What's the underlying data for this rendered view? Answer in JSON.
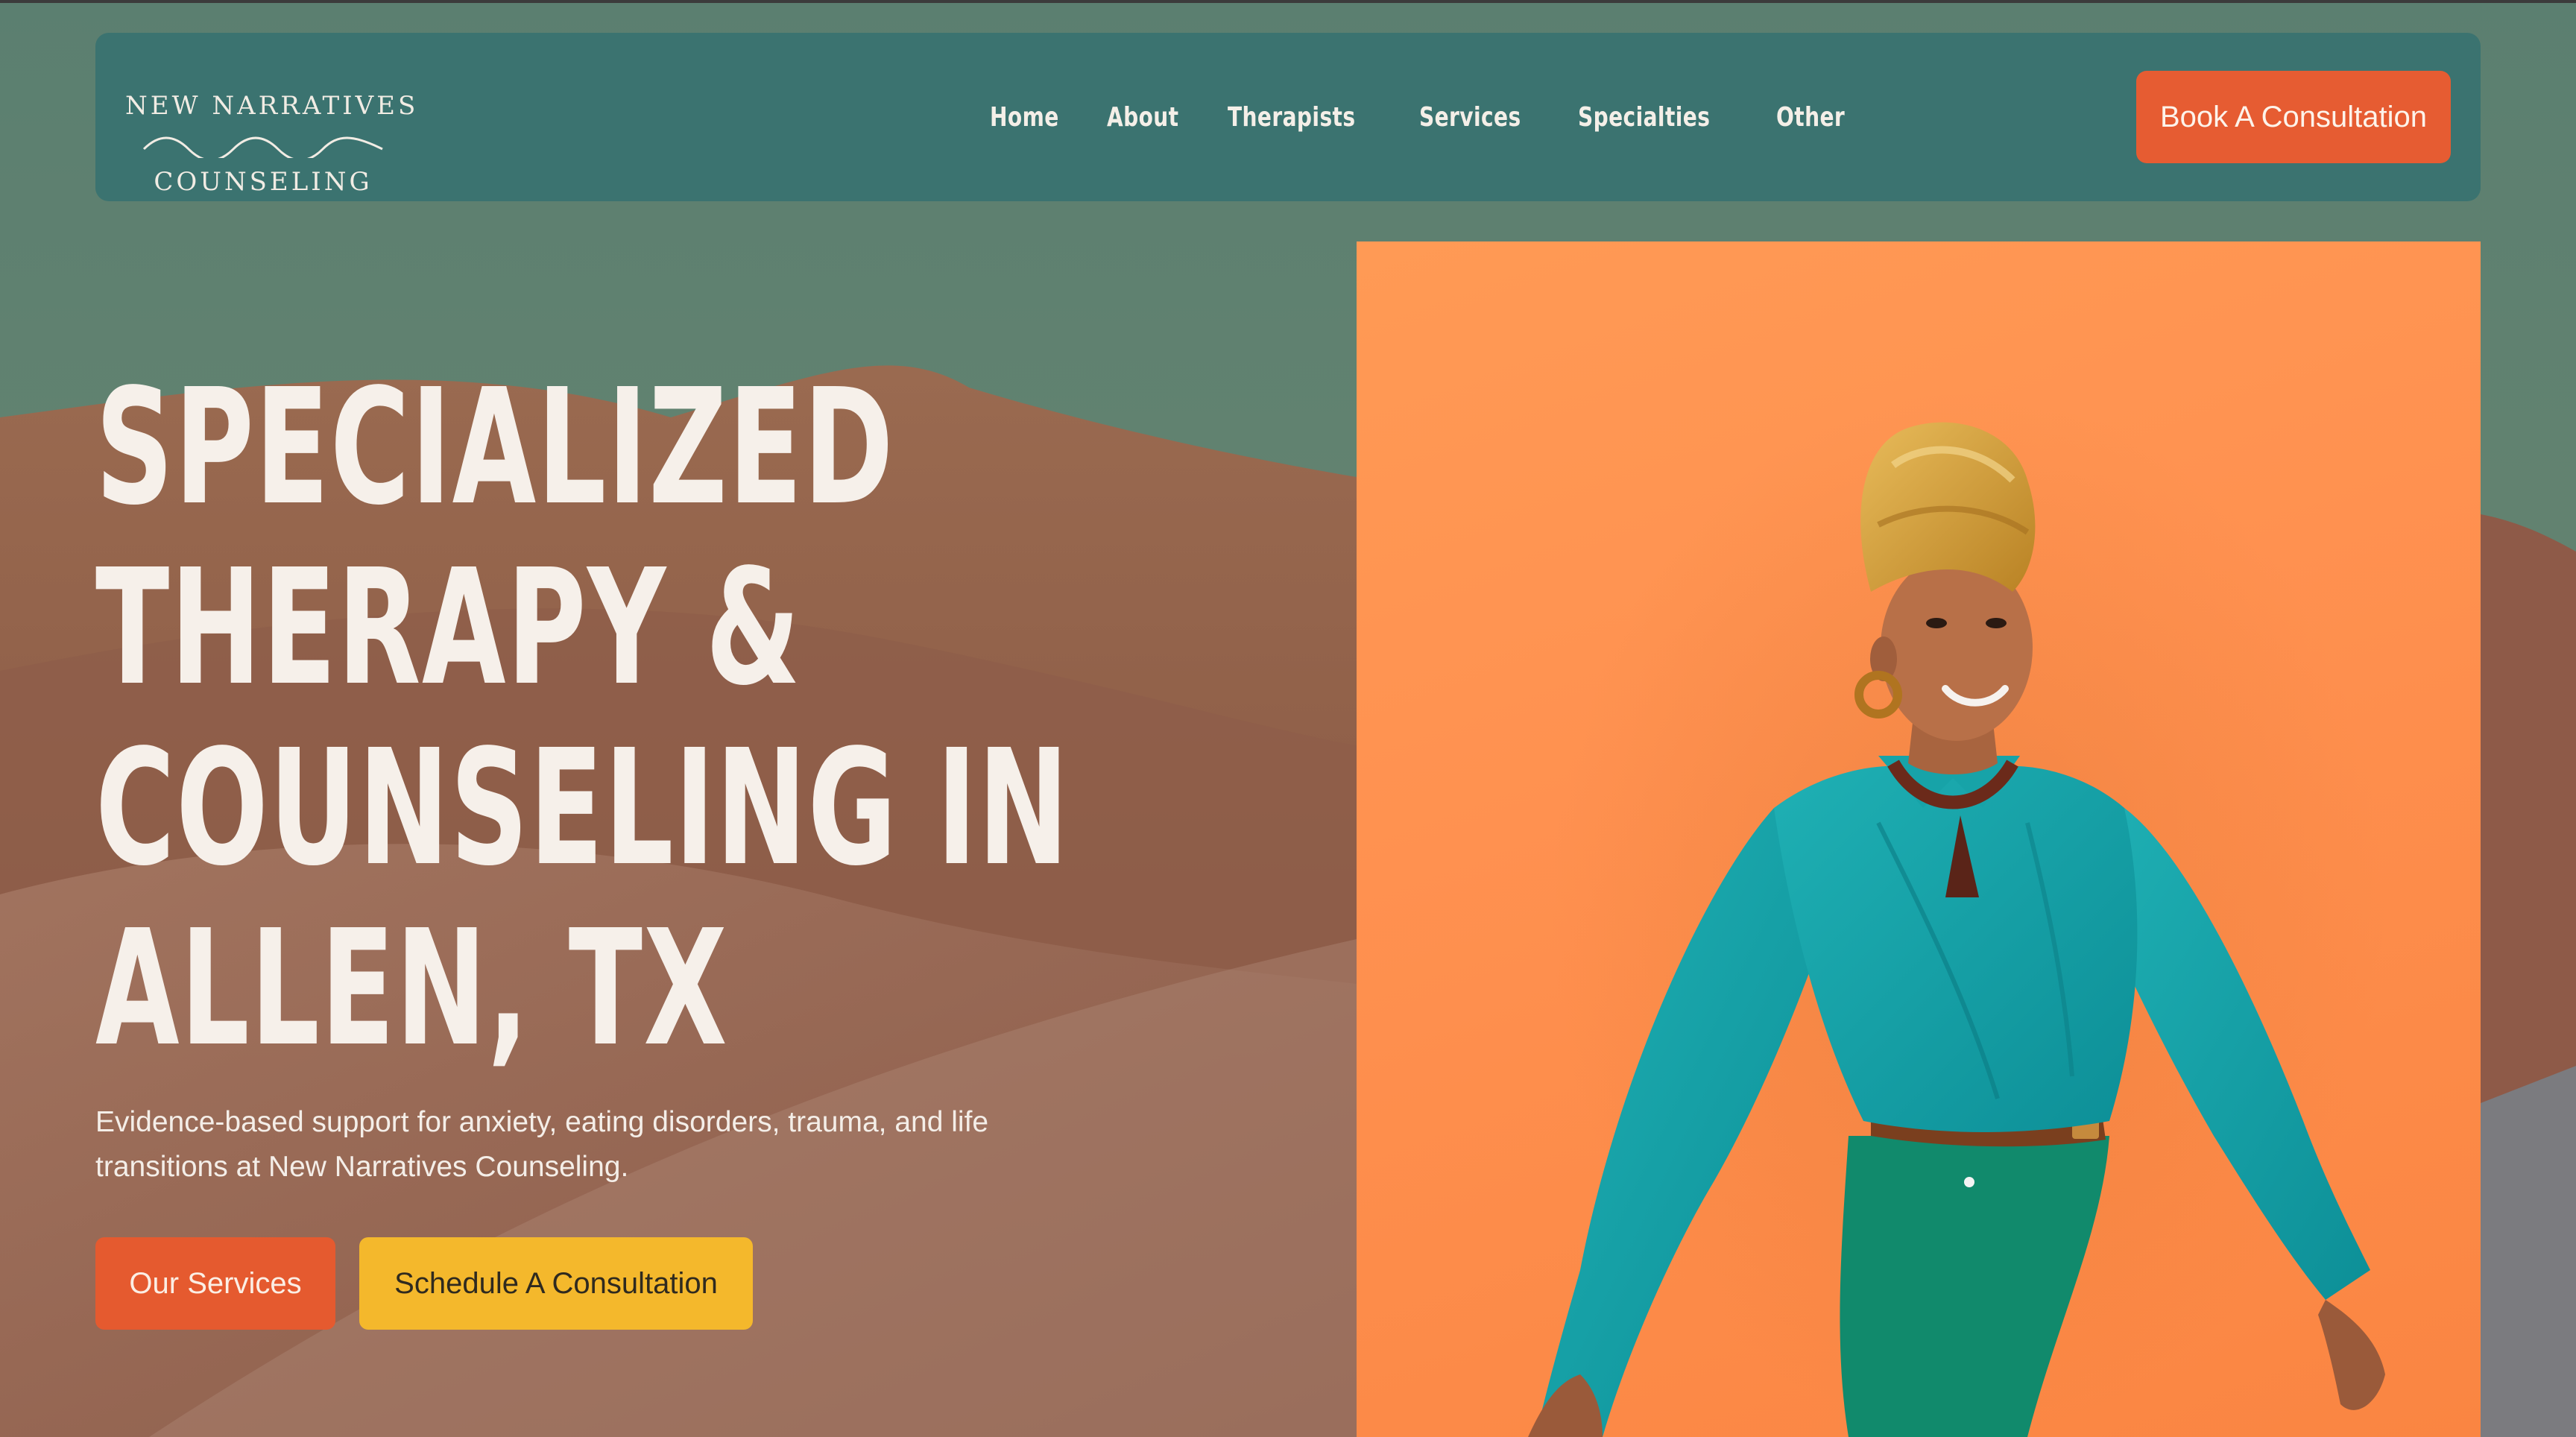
{
  "colors": {
    "nav_background": "#3b7370",
    "accent_orange": "#e65c32",
    "accent_yellow": "#f4b82c",
    "hero_text": "#f6f0ea",
    "photo_background": "#ff9150"
  },
  "brand": {
    "name_top": "NEW NARRATIVES",
    "name_bottom": "COUNSELING",
    "logo_icon": "wave-icon"
  },
  "nav": {
    "links": [
      {
        "label": "Home"
      },
      {
        "label": "About"
      },
      {
        "label": "Therapists"
      },
      {
        "label": "Services"
      },
      {
        "label": "Specialties"
      },
      {
        "label": "Other"
      }
    ],
    "cta_label": "Book A Consultation"
  },
  "hero": {
    "title_lines": [
      "SPECIALIZED",
      "THERAPY &",
      "COUNSELING IN",
      "ALLEN, TX"
    ],
    "subtitle": "Evidence-based support for anxiety, eating disorders, trauma, and life transitions at New Narratives Counseling.",
    "primary_button": "Our Services",
    "secondary_button": "Schedule A Consultation"
  },
  "photo": {
    "subject": "smiling woman in teal blouse and gold head wrap against an orange wall"
  }
}
